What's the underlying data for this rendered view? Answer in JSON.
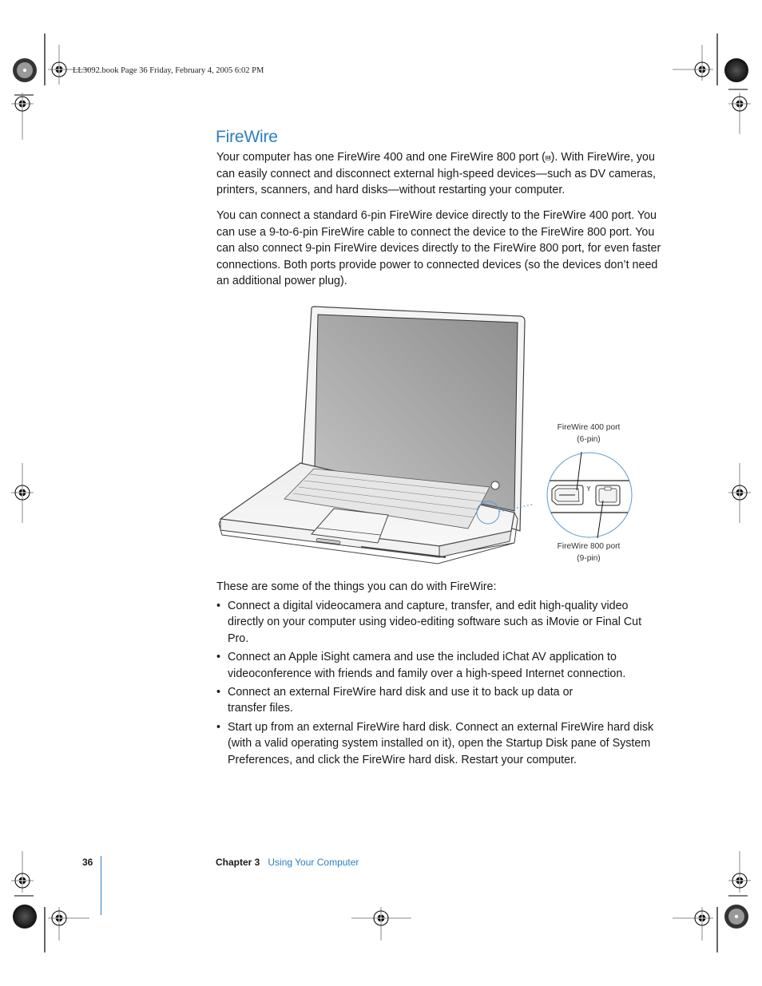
{
  "print_slug": "LL3092.book  Page 36  Friday, February 4, 2005  6:02 PM",
  "section": {
    "title": "FireWire",
    "paragraphs": [
      "Your computer has one FireWire 400 and one FireWire 800 port (‡). With FireWire, you can easily connect and disconnect external high-speed devices—such as DV cameras, printers, scanners, and hard disks—without restarting your computer.",
      "You can connect a standard 6-pin FireWire device directly to the FireWire 400 port. You can use a 9-to-6-pin FireWire cable to connect the device to the FireWire 800 port. You can also connect 9-pin FireWire devices directly to the FireWire 800 port, for even faster connections. Both ports provide power to connected devices (so the devices don’t need an additional power plug)."
    ],
    "paragraph1_parts": {
      "before_icon": "Your computer has one FireWire 400 and one FireWire 800 port (",
      "icon": "firewire-icon",
      "after_icon": "). With FireWire, you can easily connect and disconnect external high-speed devices—such as DV cameras, printers, scanners, and hard disks—without restarting your computer."
    }
  },
  "figure": {
    "callouts": {
      "fw400_line1": "FireWire 400 port",
      "fw400_line2": "(6-pin)",
      "fw800_line1": "FireWire 800 port",
      "fw800_line2": "(9-pin)"
    },
    "accent_color": "#5b9bd5"
  },
  "list": {
    "intro": "These are some of the things you can do with FireWire:",
    "bullet_char": "•",
    "items": [
      "Connect a digital videocamera and capture, transfer, and edit high-quality video directly on your computer using video-editing software such as iMovie or Final Cut Pro.",
      "Connect an Apple iSight camera and use the included iChat AV application to videoconference with friends and family over a high-speed Internet connection.",
      "Connect an external FireWire hard disk and use it to back up data or transfer files.",
      "Start up from an external FireWire hard disk. Connect an external FireWire hard disk (with a valid operating system installed on it), open the Startup Disk pane of System Preferences, and click the FireWire hard disk. Restart your computer."
    ]
  },
  "footer": {
    "page_number": "36",
    "chapter_label": "Chapter 3",
    "chapter_title": "Using Your Computer"
  },
  "colors": {
    "heading": "#2a7ec3",
    "body_text": "#1a1a1a",
    "callout_circle": "#5b9bd5"
  }
}
